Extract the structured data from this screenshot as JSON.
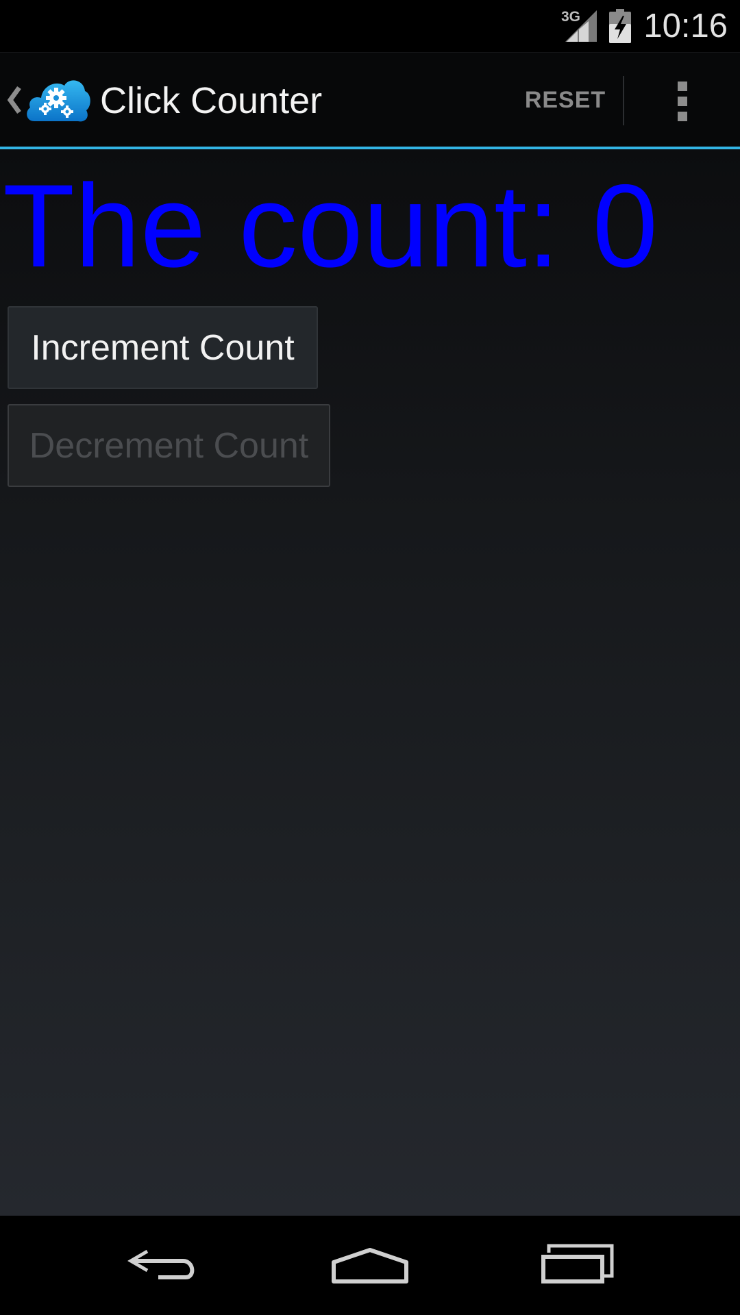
{
  "status_bar": {
    "network_type": "3G",
    "time": "10:16",
    "icons": [
      "signal-icon",
      "battery-icon"
    ]
  },
  "action_bar": {
    "title": "Click Counter",
    "reset_label": "RESET",
    "icons": [
      "up-icon",
      "app-icon",
      "overflow-menu-icon"
    ]
  },
  "main": {
    "count_text": "The count: 0",
    "count_value": 0,
    "increment_label": "Increment Count",
    "decrement_label": "Decrement Count",
    "decrement_enabled": false
  },
  "nav_bar": {
    "icons": [
      "back-icon",
      "home-icon",
      "recent-apps-icon"
    ]
  },
  "colors": {
    "count_text": "#0000ff",
    "holo_accent": "#33b5e5",
    "status_bar_bg": "#000000",
    "action_bar_bg": "#070809"
  }
}
